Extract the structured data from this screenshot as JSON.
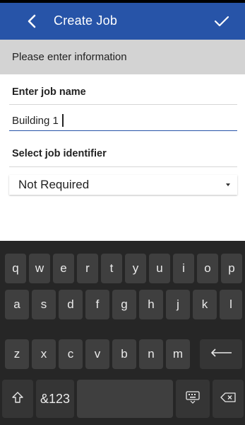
{
  "header": {
    "title": "Create Job",
    "back_icon": "back-chevron-icon",
    "confirm_icon": "checkmark-icon",
    "color": "#2754a8"
  },
  "info_banner": {
    "text": "Please enter information",
    "color": "#d3d3d3"
  },
  "form": {
    "job_name_label": "Enter job name",
    "job_name_value": "Building 1",
    "job_identifier_label": "Select job identifier",
    "job_identifier_value": "Not Required"
  },
  "keyboard": {
    "row1": [
      "q",
      "w",
      "e",
      "r",
      "t",
      "y",
      "u",
      "i",
      "o",
      "p"
    ],
    "row2": [
      "a",
      "s",
      "d",
      "f",
      "g",
      "h",
      "j",
      "k",
      "l"
    ],
    "row3": [
      "z",
      "x",
      "c",
      "v",
      "b",
      "n",
      "m"
    ],
    "symbols_label": "&123",
    "shift_icon": "shift-arrow-icon",
    "enter_icon": "enter-arrow-icon",
    "keyboard_switch_icon": "keyboard-icon",
    "backspace_icon": "backspace-icon"
  }
}
